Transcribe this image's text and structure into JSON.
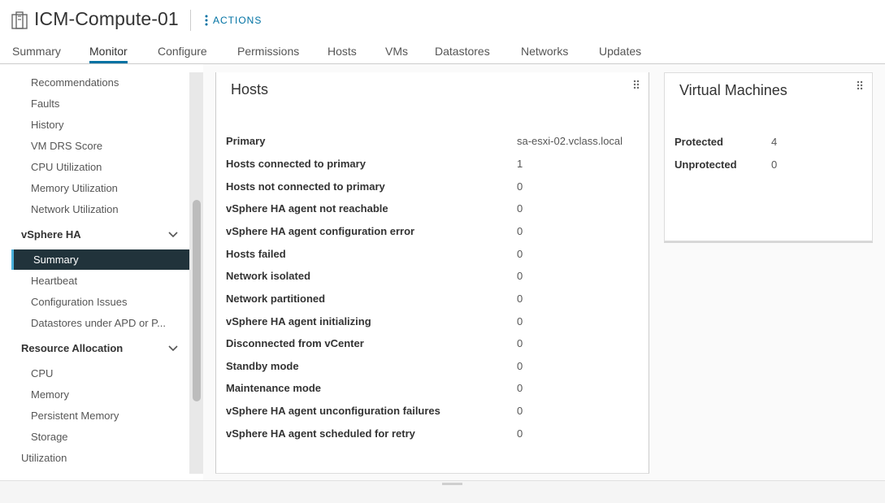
{
  "header": {
    "title": "ICM-Compute-01",
    "actions_label": "ACTIONS",
    "object_icon": "cluster-icon",
    "actions_icon": "vertical-ellipsis-icon"
  },
  "tabs": [
    {
      "label": "Summary"
    },
    {
      "label": "Monitor",
      "active": true
    },
    {
      "label": "Configure"
    },
    {
      "label": "Permissions"
    },
    {
      "label": "Hosts"
    },
    {
      "label": "VMs"
    },
    {
      "label": "Datastores"
    },
    {
      "label": "Networks"
    },
    {
      "label": "Updates"
    }
  ],
  "sidebar": {
    "top_items": [
      "Recommendations",
      "Faults",
      "History",
      "VM DRS Score",
      "CPU Utilization",
      "Memory Utilization",
      "Network Utilization"
    ],
    "vsphere_ha": {
      "label": "vSphere HA",
      "items": [
        "Summary",
        "Heartbeat",
        "Configuration Issues",
        "Datastores under APD or P..."
      ],
      "selected": "Summary"
    },
    "resource_allocation": {
      "label": "Resource Allocation",
      "items": [
        "CPU",
        "Memory",
        "Persistent Memory",
        "Storage"
      ]
    },
    "utilization": "Utilization"
  },
  "hosts_card": {
    "title": "Hosts",
    "rows": [
      {
        "label": "Primary",
        "value": "sa-esxi-02.vclass.local"
      },
      {
        "label": "Hosts connected to primary",
        "value": "1"
      },
      {
        "label": "Hosts not connected to primary",
        "value": "0"
      },
      {
        "label": "vSphere HA agent not reachable",
        "value": "0"
      },
      {
        "label": "vSphere HA agent configuration error",
        "value": "0"
      },
      {
        "label": "Hosts failed",
        "value": "0"
      },
      {
        "label": "Network isolated",
        "value": "0"
      },
      {
        "label": "Network partitioned",
        "value": "0"
      },
      {
        "label": "vSphere HA agent initializing",
        "value": "0"
      },
      {
        "label": "Disconnected from vCenter",
        "value": "0"
      },
      {
        "label": "Standby mode",
        "value": "0"
      },
      {
        "label": "Maintenance mode",
        "value": "0"
      },
      {
        "label": "vSphere HA agent unconfiguration failures",
        "value": "0"
      },
      {
        "label": "vSphere HA agent scheduled for retry",
        "value": "0"
      }
    ]
  },
  "vms_card": {
    "title": "Virtual Machines",
    "rows": [
      {
        "label": "Protected",
        "value": "4"
      },
      {
        "label": "Unprotected",
        "value": "0"
      }
    ]
  },
  "colors": {
    "accent": "#0072a3",
    "selected_bg": "#21333b",
    "selected_bar": "#49afd9"
  }
}
